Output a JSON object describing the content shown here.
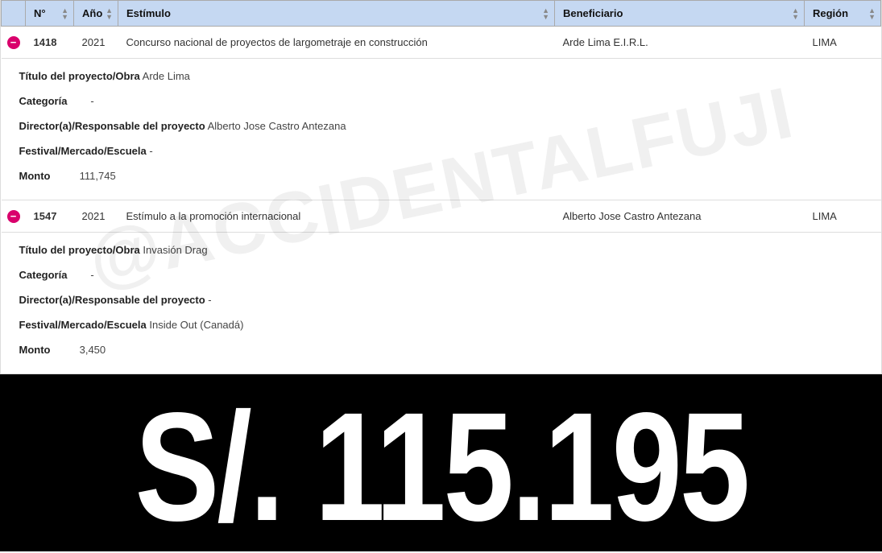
{
  "watermark": "@ACCIDENTALFUJI",
  "headers": {
    "n": "N°",
    "ano": "Año",
    "estimulo": "Estímulo",
    "beneficiario": "Beneficiario",
    "region": "Región"
  },
  "detail_labels": {
    "titulo": "Título del proyecto/Obra",
    "categoria": "Categoría",
    "director": "Director(a)/Responsable del proyecto",
    "festival": "Festival/Mercado/Escuela",
    "monto": "Monto"
  },
  "rows": [
    {
      "n": "1418",
      "ano": "2021",
      "estimulo": "Concurso nacional de proyectos de largometraje en construcción",
      "beneficiario": "Arde Lima E.I.R.L.",
      "region": "LIMA",
      "detail": {
        "titulo": "Arde Lima",
        "categoria": "-",
        "director": "Alberto Jose Castro Antezana",
        "festival": "-",
        "monto": "111,745"
      }
    },
    {
      "n": "1547",
      "ano": "2021",
      "estimulo": "Estímulo a la promoción internacional",
      "beneficiario": "Alberto Jose Castro Antezana",
      "region": "LIMA",
      "detail": {
        "titulo": "Invasión Drag",
        "categoria": "-",
        "director": "-",
        "festival": "Inside Out (Canadá)",
        "monto": "3,450"
      }
    }
  ],
  "total": "S/. 115.195"
}
